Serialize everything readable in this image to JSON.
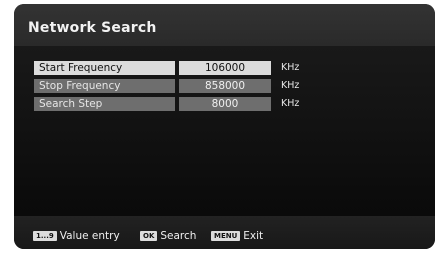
{
  "header": {
    "title": "Network Search"
  },
  "rows": [
    {
      "label": "Start Frequency",
      "value": "106000",
      "unit": "KHz",
      "state": "selected"
    },
    {
      "label": "Stop Frequency",
      "value": "858000",
      "unit": "KHz",
      "state": "normal"
    },
    {
      "label": "Search Step",
      "value": "8000",
      "unit": "KHz",
      "state": "normal"
    }
  ],
  "footer": {
    "hints": [
      {
        "key": "1...9",
        "text": "Value entry"
      },
      {
        "key": "OK",
        "text": "Search"
      },
      {
        "key": "MENU",
        "text": "Exit"
      }
    ]
  }
}
